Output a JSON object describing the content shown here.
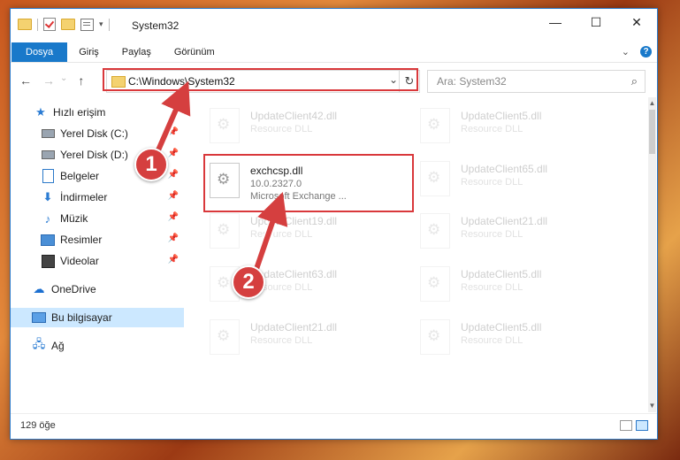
{
  "window": {
    "title": "System32",
    "controls": {
      "minimize": "—",
      "maximize": "☐",
      "close": "✕"
    }
  },
  "quick_access_toolbar": {
    "dropdown_glyph": "▾"
  },
  "ribbon": {
    "tabs": [
      "Dosya",
      "Giriş",
      "Paylaş",
      "Görünüm"
    ],
    "collapse_glyph": "⌄",
    "help_glyph": "?"
  },
  "navigation": {
    "back_glyph": "←",
    "forward_glyph": "→",
    "recent_glyph": "⌄",
    "up_glyph": "↑",
    "address": "C:\\Windows\\System32",
    "address_dropdown_glyph": "⌄",
    "refresh_glyph": "↻",
    "search_placeholder": "Ara: System32",
    "search_glyph": "⌕"
  },
  "sidebar": {
    "items": [
      {
        "label": "Hızlı erişim",
        "icon": "star-icon",
        "pinned": false
      },
      {
        "label": "Yerel Disk (C:)",
        "icon": "drive-icon",
        "pinned": true
      },
      {
        "label": "Yerel Disk (D:)",
        "icon": "drive-icon",
        "pinned": true
      },
      {
        "label": "Belgeler",
        "icon": "documents-icon",
        "pinned": true
      },
      {
        "label": "İndirmeler",
        "icon": "downloads-icon",
        "pinned": true
      },
      {
        "label": "Müzik",
        "icon": "music-icon",
        "pinned": true
      },
      {
        "label": "Resimler",
        "icon": "pictures-icon",
        "pinned": true
      },
      {
        "label": "Videolar",
        "icon": "videos-icon",
        "pinned": true
      },
      {
        "label": "OneDrive",
        "icon": "cloud-icon",
        "pinned": false
      },
      {
        "label": "Bu bilgisayar",
        "icon": "computer-icon",
        "pinned": false,
        "selected": true
      },
      {
        "label": "Ağ",
        "icon": "network-icon",
        "pinned": false
      }
    ],
    "pin_glyph": "📌"
  },
  "files": [
    {
      "name": "UpdateClient42.dll",
      "type": "Resource DLL",
      "faded": true
    },
    {
      "name": "UpdateClient5.dll",
      "type": "Resource DLL",
      "faded": true
    },
    {
      "name": "exchcsp.dll",
      "version": "10.0.2327.0",
      "type": "Microsoft Exchange ...",
      "faded": false,
      "highlighted": true
    },
    {
      "name": "UpdateClient65.dll",
      "type": "Resource DLL",
      "faded": true
    },
    {
      "name": "UpdateClient19.dll",
      "type": "Resource DLL",
      "faded": true
    },
    {
      "name": "UpdateClient21.dll",
      "type": "Resource DLL",
      "faded": true
    },
    {
      "name": "UpdateClient63.dll",
      "type": "Resource DLL",
      "faded": true
    },
    {
      "name": "UpdateClient5.dll",
      "type": "Resource DLL",
      "faded": true
    },
    {
      "name": "UpdateClient21.dll",
      "type": "Resource DLL",
      "faded": true
    },
    {
      "name": "UpdateClient5.dll",
      "type": "Resource DLL",
      "faded": true
    }
  ],
  "status_bar": {
    "item_count": "129 öğe"
  },
  "scrollbar": {
    "up_glyph": "▲",
    "down_glyph": "▼"
  },
  "annotations": {
    "step1": "1",
    "step2": "2"
  },
  "colors": {
    "accent": "#1979ca",
    "highlight": "#d9383b",
    "selection": "#cce8ff"
  }
}
